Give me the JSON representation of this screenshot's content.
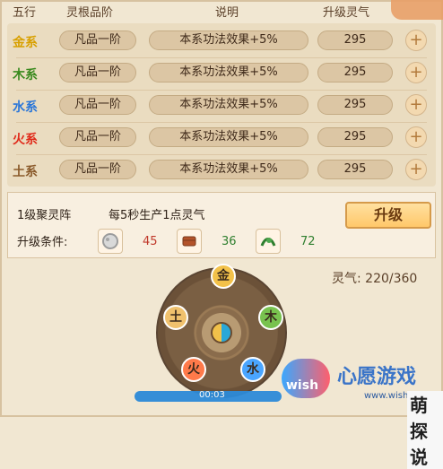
{
  "header": {
    "col1": "五行",
    "col2": "灵根品阶",
    "col3": "说明",
    "col4": "升级灵气"
  },
  "rows": [
    {
      "element": "金系",
      "color": "#d8a000",
      "grade": "凡品一阶",
      "desc": "本系功法效果+5%",
      "cost": "295"
    },
    {
      "element": "木系",
      "color": "#3a8a1f",
      "grade": "凡品一阶",
      "desc": "本系功法效果+5%",
      "cost": "295"
    },
    {
      "element": "水系",
      "color": "#2a76d8",
      "grade": "凡品一阶",
      "desc": "本系功法效果+5%",
      "cost": "295"
    },
    {
      "element": "火系",
      "color": "#e02a1a",
      "grade": "凡品一阶",
      "desc": "本系功法效果+5%",
      "cost": "295"
    },
    {
      "element": "土系",
      "color": "#8a5a2a",
      "grade": "凡品一阶",
      "desc": "本系功法效果+5%",
      "cost": "295"
    }
  ],
  "panel": {
    "level_name": "1级聚灵阵",
    "production": "每5秒生产1点灵气",
    "cond_label": "升级条件:",
    "upgrade_label": "升级",
    "req": [
      {
        "icon": "ore-icon",
        "value": "45",
        "color": "#c0392b"
      },
      {
        "icon": "wood-icon",
        "value": "36",
        "color": "#2f7f2f"
      },
      {
        "icon": "herb-icon",
        "value": "72",
        "color": "#2f7f2f"
      }
    ]
  },
  "lingqi": "灵气: 220/360",
  "wheel": {
    "top": "金",
    "right": "木",
    "bottom_right": "水",
    "bottom_left": "火",
    "left": "土"
  },
  "player": {
    "time": "00:03"
  },
  "watermark": {
    "logo_word": "wish",
    "title": "心愿游戏",
    "url": "www.wishsee.com",
    "tag": "萌探说"
  },
  "colors": {
    "accent_blue": "#2c8ad8",
    "panel_bg": "#f1e7d2"
  }
}
